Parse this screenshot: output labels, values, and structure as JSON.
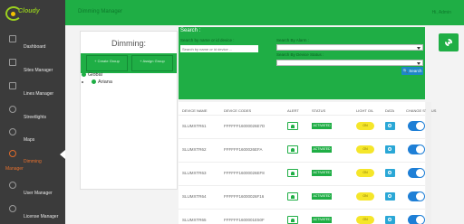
{
  "sidebar": {
    "brand": "Cloudy",
    "items": [
      {
        "label": "Dashboard",
        "icon": "home-icon"
      },
      {
        "label": "Sites Manager",
        "icon": "sites-icon"
      },
      {
        "label": "Lines Manager",
        "icon": "lines-icon"
      },
      {
        "label": "Streetlights",
        "icon": "bulb-icon"
      },
      {
        "label": "Maps",
        "icon": "map-pin-icon"
      },
      {
        "label": "Dimming",
        "label2": "Manager",
        "icon": "gear-icon"
      },
      {
        "label": "User Manager",
        "icon": "user-icon"
      },
      {
        "label": "License Manager",
        "icon": "license-icon"
      }
    ]
  },
  "header": {
    "title": "Dimming Manager",
    "user": "Hi, Admin"
  },
  "tree": {
    "title": "Dimming:",
    "btn1": "+ Create Group",
    "btn2": "+ Assign Group",
    "nodes": [
      {
        "label": "Global"
      },
      {
        "label": "Ariana"
      }
    ]
  },
  "search": {
    "title": "Search :",
    "name_label": "Search by name or id device :",
    "name_placeholder": "Search by name or id device ...",
    "alarm_label": "Search By Alarm :",
    "status_label": "Search By Device Status :",
    "button": "Search"
  },
  "table": {
    "headers": [
      "DEVICE NAME",
      "DEVICE CODES",
      "ALERT",
      "STATUS",
      "LIGHT O/L",
      "DATA",
      "CHANGE STATUS"
    ],
    "rows": [
      {
        "name": "SLUMXTR61",
        "code": "FFFFFF16000026E7D",
        "status": "ACTIVATED",
        "light": "ON"
      },
      {
        "name": "SLUMXTR62",
        "code": "FFFFFF1600026EFA",
        "status": "ACTIVATED",
        "light": "ON"
      },
      {
        "name": "SLUMXTR63",
        "code": "FFFFFF16000026EF8",
        "status": "ACTIVATED",
        "light": "ON"
      },
      {
        "name": "SLUMXTR64",
        "code": "FFFFFF16000026F16",
        "status": "ACTIVATED",
        "light": "ON"
      },
      {
        "name": "SLUMXTR65",
        "code": "FFFFFF1600001E50F",
        "status": "ACTIVATED",
        "light": "ON"
      }
    ]
  },
  "colors": {
    "accent": "#1fae45",
    "active": "#e8712e",
    "sidebar": "#3b3b3b"
  }
}
